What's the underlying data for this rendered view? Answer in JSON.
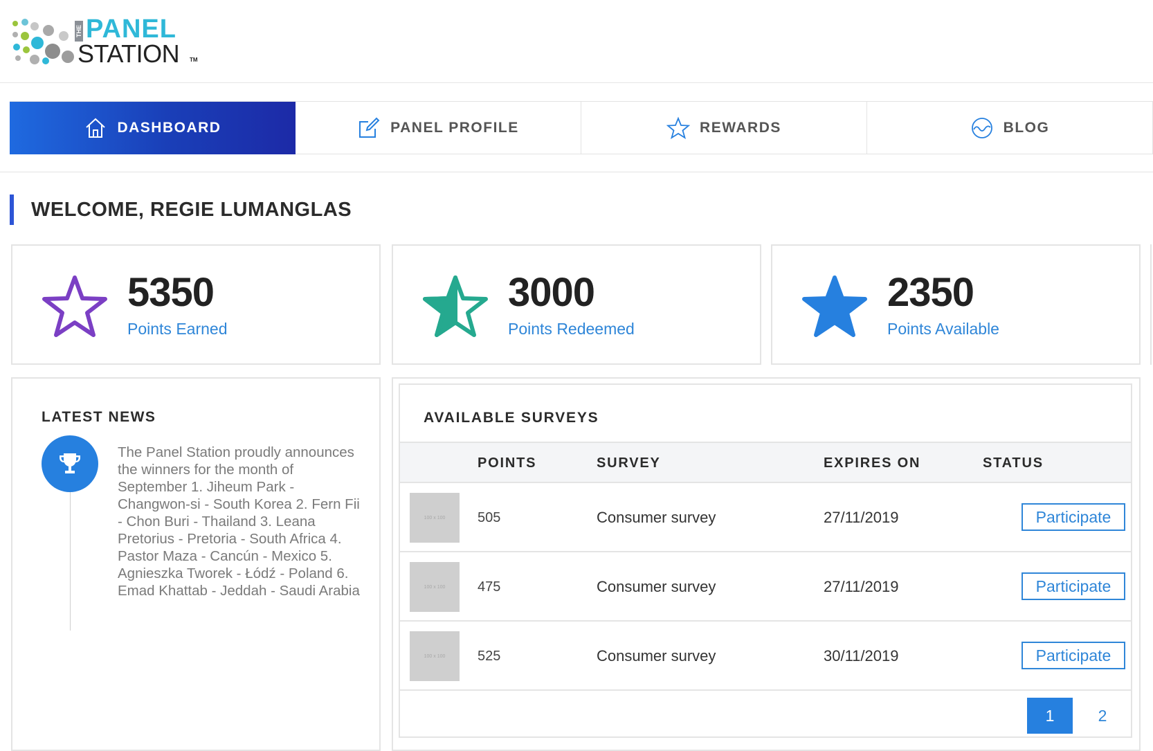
{
  "brand": {
    "logo_small": "THE",
    "logo_top": "PANEL",
    "logo_bottom": "STATION",
    "logo_tm": "TM"
  },
  "nav": {
    "items": [
      {
        "label": "DASHBOARD",
        "icon": "home-icon",
        "active": true
      },
      {
        "label": "PANEL PROFILE",
        "icon": "edit-icon",
        "active": false
      },
      {
        "label": "REWARDS",
        "icon": "star-outline-icon",
        "active": false
      },
      {
        "label": "BLOG",
        "icon": "wave-circle-icon",
        "active": false
      }
    ]
  },
  "welcome": "WELCOME, REGIE LUMANGLAS",
  "stats": [
    {
      "value": "5350",
      "label": "Points Earned",
      "icon": "star-outline-icon",
      "color": "#7b3fc4"
    },
    {
      "value": "3000",
      "label": "Points Redeemed",
      "icon": "star-half-icon",
      "color": "#25a98f"
    },
    {
      "value": "2350",
      "label": "Points Available",
      "icon": "star-filled-icon",
      "color": "#2680df"
    }
  ],
  "news": {
    "title": "LATEST NEWS",
    "icon": "trophy-icon",
    "text": "The Panel Station proudly announces the winners for the month of September 1. Jiheum Park - Changwon-si - South Korea 2. Fern Fii - Chon Buri - Thailand 3. Leana Pretorius - Pretoria - South Africa 4. Pastor Maza - Cancún - Mexico 5. Agnieszka Tworek - Łódź - Poland 6. Emad Khattab - Jeddah - Saudi Arabia"
  },
  "surveys": {
    "title": "AVAILABLE SURVEYS",
    "columns": {
      "points": "POINTS",
      "survey": "SURVEY",
      "expires": "EXPIRES ON",
      "status": "STATUS"
    },
    "thumb_label": "100 x 100",
    "rows": [
      {
        "points": "505",
        "survey": "Consumer survey",
        "expires": "27/11/2019",
        "action": "Participate"
      },
      {
        "points": "475",
        "survey": "Consumer survey",
        "expires": "27/11/2019",
        "action": "Participate"
      },
      {
        "points": "525",
        "survey": "Consumer survey",
        "expires": "30/11/2019",
        "action": "Participate"
      }
    ],
    "pages": [
      "1",
      "2"
    ],
    "current_page": "1"
  },
  "colors": {
    "accent": "#2680df",
    "link": "#2f86d8",
    "nav_gradient_start": "#1f6ae0",
    "nav_gradient_end": "#1c2aa7"
  }
}
